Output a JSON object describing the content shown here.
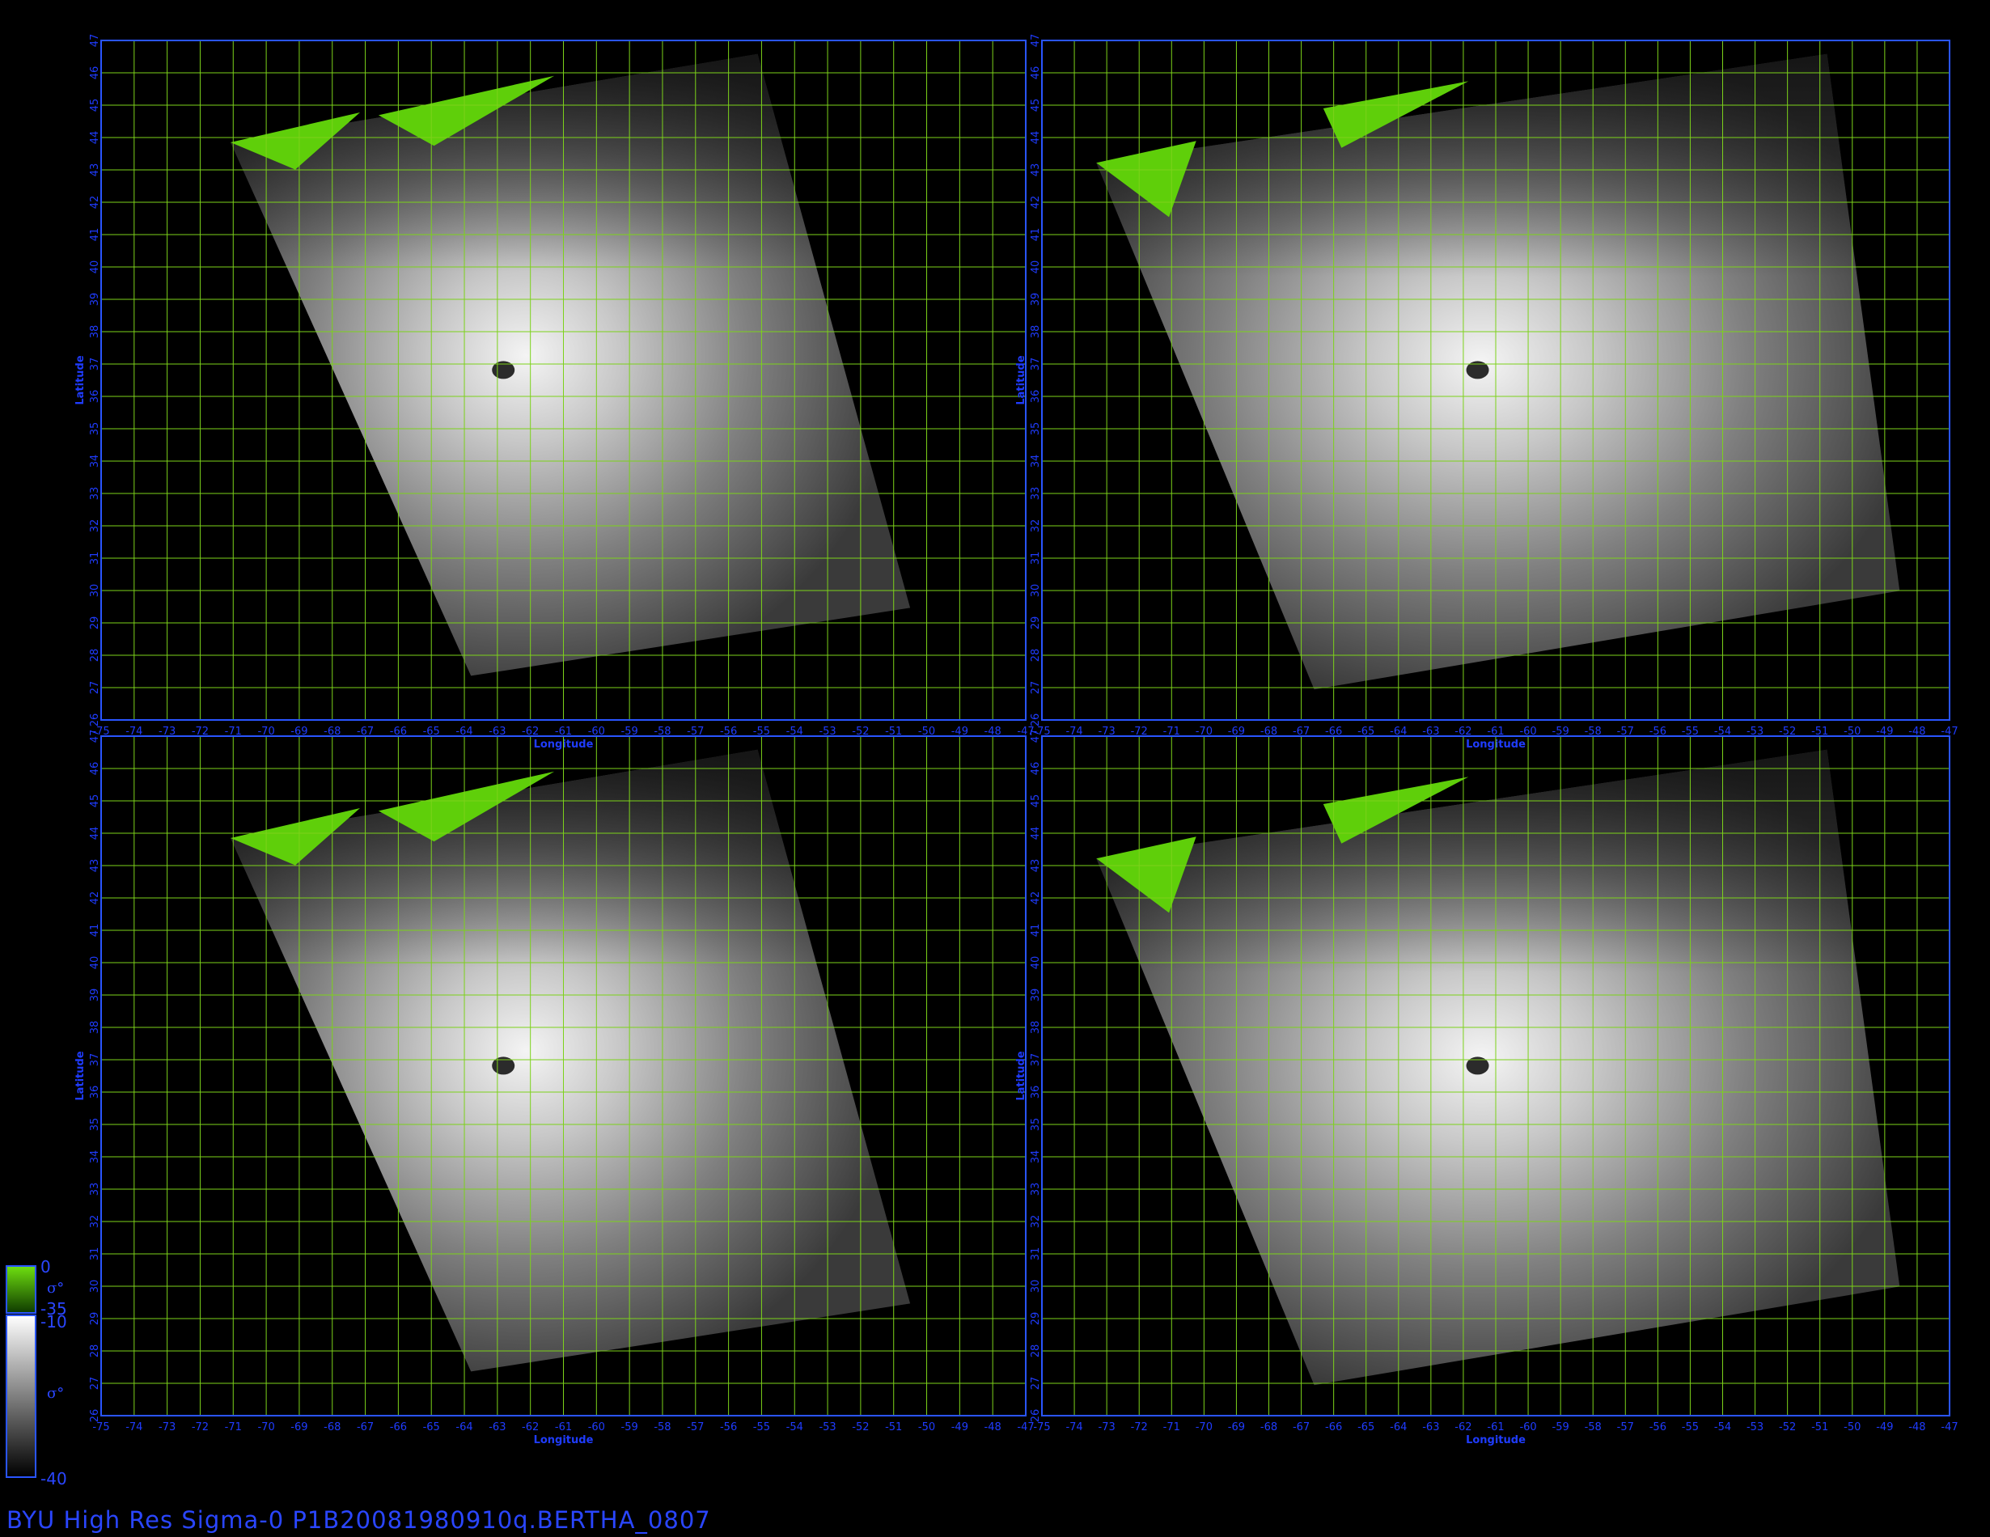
{
  "figure": {
    "footer_title": "BYU  High  Res  Sigma-0  P1B20081980910q.BERTHA_0807",
    "colors": {
      "background": "#000000",
      "frame": "#2a55ff",
      "grid": "#7cd21a",
      "land": "#5fcf0a",
      "label": "#1f3cff"
    }
  },
  "colorbar": {
    "land": {
      "top_label": "0",
      "bottom_label": "-35",
      "symbol": "σ°"
    },
    "ocean": {
      "top_label": "-10",
      "bottom_label": "-40",
      "symbol": "σ°"
    }
  },
  "axes": {
    "x_label": "Longitude",
    "y_label": "Latitude",
    "x_ticks": [
      "-75",
      "-74",
      "-73",
      "-72",
      "-71",
      "-70",
      "-69",
      "-68",
      "-67",
      "-66",
      "-65",
      "-64",
      "-63",
      "-62",
      "-61",
      "-60",
      "-59",
      "-58",
      "-57",
      "-56",
      "-55",
      "-54",
      "-53",
      "-52",
      "-51",
      "-50",
      "-49",
      "-48",
      "-47"
    ],
    "y_ticks": [
      "26",
      "27",
      "28",
      "29",
      "30",
      "31",
      "32",
      "33",
      "34",
      "35",
      "36",
      "37",
      "38",
      "39",
      "40",
      "41",
      "42",
      "43",
      "44",
      "45",
      "46",
      "47"
    ]
  },
  "panels": [
    {
      "id": "top-left",
      "swath": "narrow"
    },
    {
      "id": "top-right",
      "swath": "wide"
    },
    {
      "id": "bottom-left",
      "swath": "narrow"
    },
    {
      "id": "bottom-right",
      "swath": "wide"
    }
  ]
}
